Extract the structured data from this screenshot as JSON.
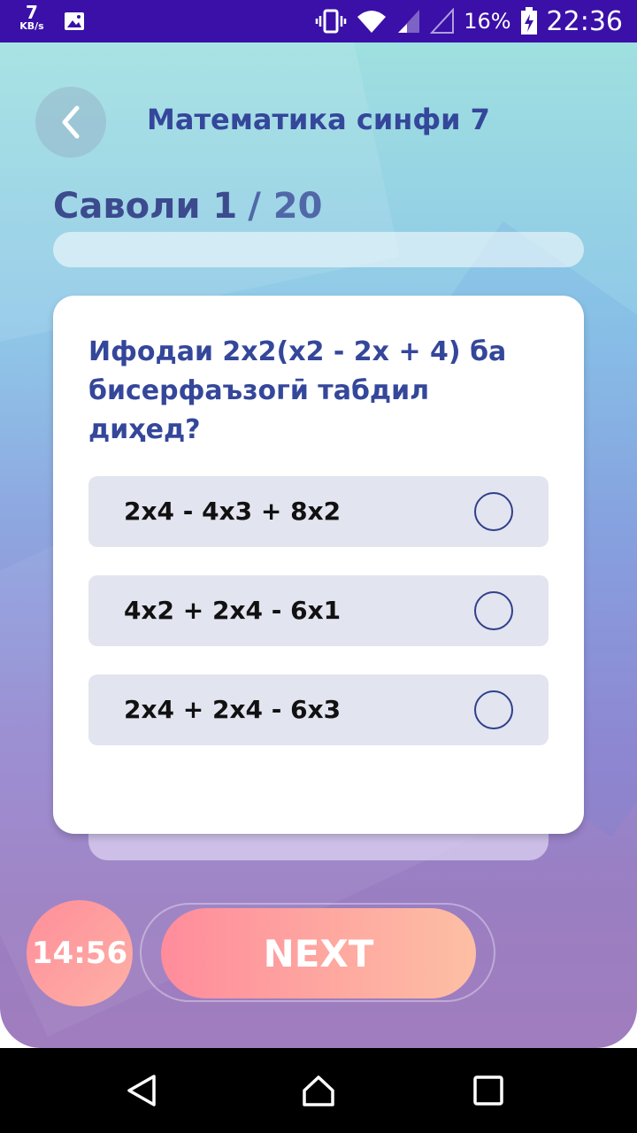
{
  "status_bar": {
    "net_speed_value": "7",
    "net_speed_unit": "KB/s",
    "battery_percent": "16%",
    "time": "22:36"
  },
  "header": {
    "title": "Математика синфи 7"
  },
  "question_counter": {
    "current": "Саволи 1",
    "total": "/ 20",
    "progress": 0.0
  },
  "question": {
    "text": "Ифодаи 2x2(x2 - 2x + 4) ба бисерфаъзогӣ табдил диҳед?",
    "options": [
      {
        "label": "2x4 - 4x3 + 8x2"
      },
      {
        "label": "4x2 + 2x4 - 6x1"
      },
      {
        "label": "2x4 + 2x4 - 6x3"
      }
    ]
  },
  "footer": {
    "timer": "14:56",
    "next_label": "NEXT"
  },
  "icons": {
    "back": "chevron-left-icon",
    "radio": "radio-unchecked-icon"
  },
  "colors": {
    "status_bar": "#3a10a8",
    "title": "#34479a",
    "option_bg": "#e2e4ef",
    "next_gradient_start": "#ff8c9c",
    "next_gradient_end": "#fdbfa4"
  }
}
